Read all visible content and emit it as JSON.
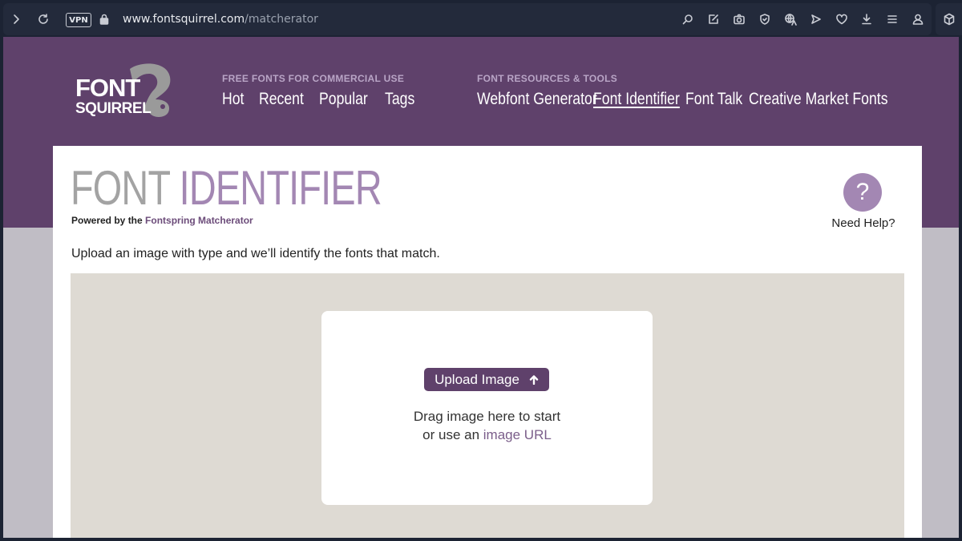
{
  "browser": {
    "vpn_label": "VPN",
    "url_host": "www.fontsquirrel.com",
    "url_path": "/matcherator"
  },
  "logo": {
    "line1": "FONT",
    "line2": "SQUIRREL"
  },
  "nav": {
    "free_fonts": {
      "caption": "FREE FONTS FOR COMMERCIAL USE",
      "links": [
        "Hot",
        "Recent",
        "Popular",
        "Tags"
      ]
    },
    "resources": {
      "caption": "FONT RESOURCES & TOOLS",
      "links": [
        "Webfont Generator",
        "Font Identifier",
        "Font Talk",
        "Creative Market Fonts"
      ],
      "active": "Font Identifier"
    }
  },
  "page": {
    "title_part1": "FONT",
    "title_part2": "IDENTIFIER",
    "powered_prefix": "Powered by the",
    "powered_link": "Fontspring Matcherator",
    "help_symbol": "?",
    "help_label": "Need Help?",
    "intro": "Upload an image with type and we’ll identify the fonts that match."
  },
  "upload": {
    "button_label": "Upload Image",
    "drag_line1": "Drag image here to start",
    "drag_line2_prefix": "or use an",
    "drag_line2_link": "image URL"
  },
  "colors": {
    "header_bg": "#5f416b",
    "accent_purple": "#a387b3",
    "dropzone_bg": "#dedad3"
  }
}
